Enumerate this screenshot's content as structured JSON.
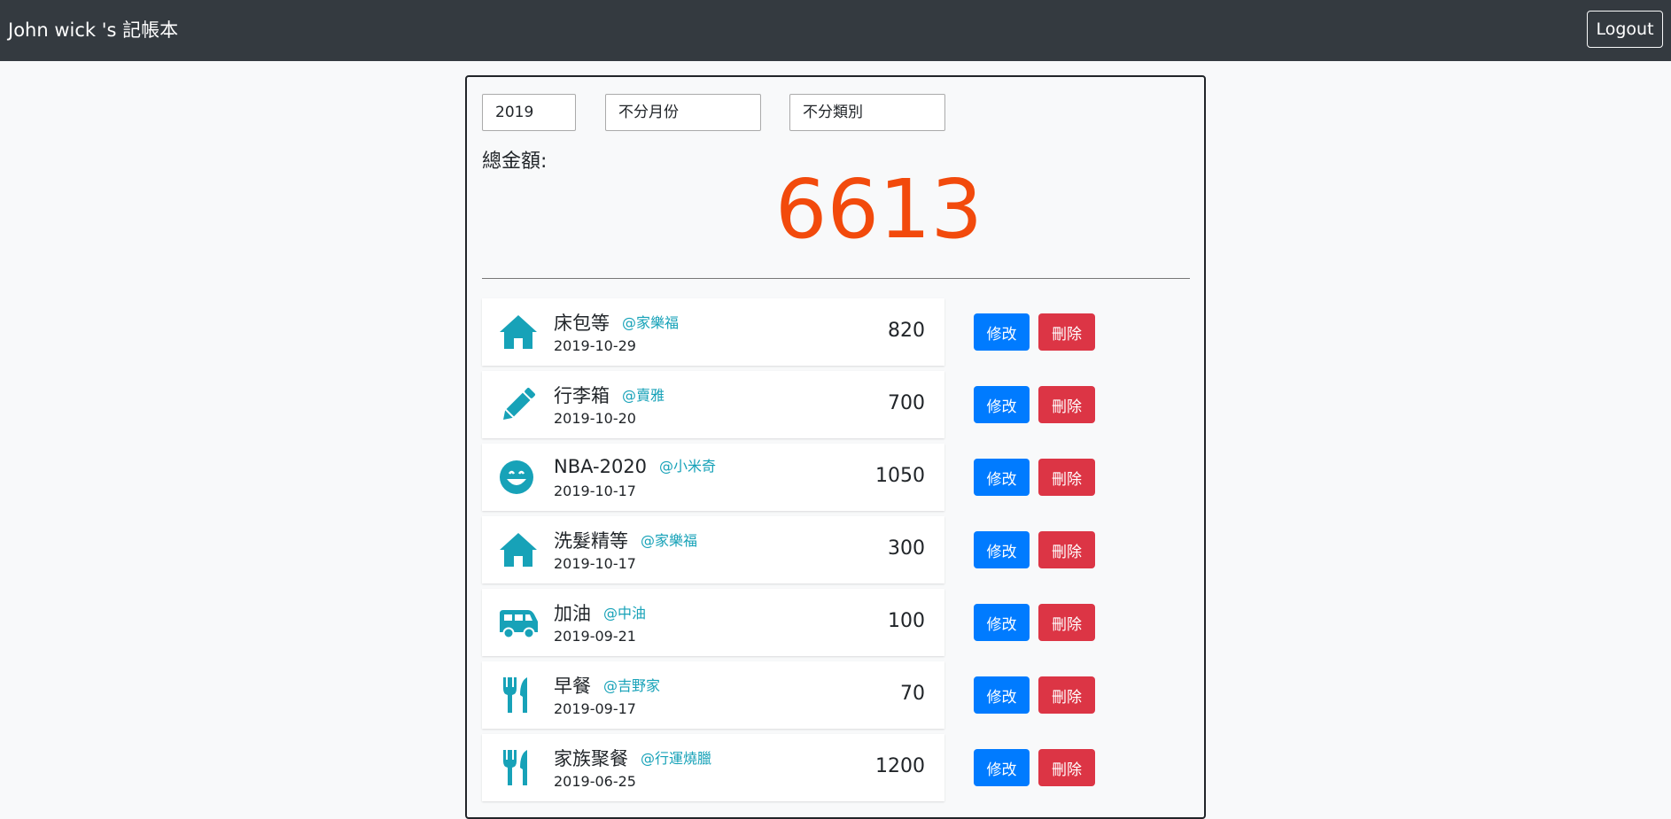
{
  "app": {
    "title": "John wick 's 記帳本",
    "logout_label": "Logout"
  },
  "filters": {
    "year": "2019",
    "month": "不分月份",
    "category": "不分類別"
  },
  "summary": {
    "label": "總金額:",
    "total": "6613"
  },
  "colors": {
    "navbar": "#343a40",
    "total": "#f24a0c",
    "icon": "#17a2b8",
    "edit_button": "#007bff",
    "delete_button": "#dc3545"
  },
  "actions": {
    "edit_label": "修改",
    "delete_label": "刪除"
  },
  "entries": [
    {
      "icon": "home-icon",
      "name": "床包等",
      "store": "@家樂福",
      "date": "2019-10-29",
      "amount": "820"
    },
    {
      "icon": "pencil-icon",
      "name": "行李箱",
      "store": "@賣雅",
      "date": "2019-10-20",
      "amount": "700"
    },
    {
      "icon": "smile-icon",
      "name": "NBA-2020",
      "store": "@小米奇",
      "date": "2019-10-17",
      "amount": "1050"
    },
    {
      "icon": "home-icon",
      "name": "洗髮精等",
      "store": "@家樂福",
      "date": "2019-10-17",
      "amount": "300"
    },
    {
      "icon": "van-icon",
      "name": "加油",
      "store": "@中油",
      "date": "2019-09-21",
      "amount": "100"
    },
    {
      "icon": "utensils-icon",
      "name": "早餐",
      "store": "@吉野家",
      "date": "2019-09-17",
      "amount": "70"
    },
    {
      "icon": "utensils-icon",
      "name": "家族聚餐",
      "store": "@行運燒臘",
      "date": "2019-06-25",
      "amount": "1200"
    }
  ]
}
